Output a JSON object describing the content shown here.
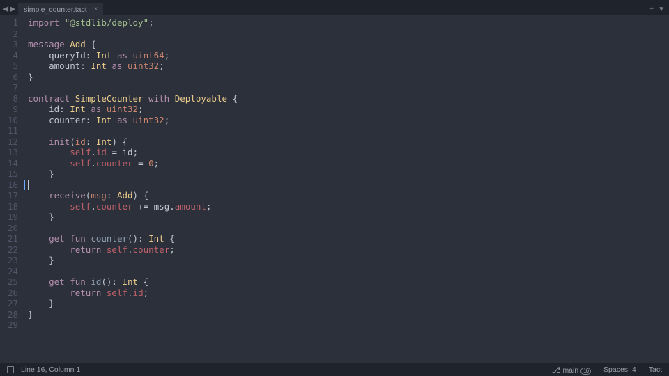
{
  "tab": {
    "filename": "simple_counter.tact",
    "nav_back": "◀",
    "nav_fwd": "▶",
    "close": "×",
    "plus": "+",
    "menu": "▼"
  },
  "cursor_line_index": 15,
  "code_lines": [
    [
      {
        "t": "import ",
        "c": "kw"
      },
      {
        "t": "\"@stdlib/deploy\"",
        "c": "str"
      },
      {
        "t": ";",
        "c": "pun"
      }
    ],
    [],
    [
      {
        "t": "message ",
        "c": "kw"
      },
      {
        "t": "Add ",
        "c": "ty2"
      },
      {
        "t": "{",
        "c": "pun"
      }
    ],
    [
      {
        "t": "    queryId",
        "c": "id"
      },
      {
        "t": ": ",
        "c": "pun"
      },
      {
        "t": "Int ",
        "c": "ty"
      },
      {
        "t": "as ",
        "c": "kw"
      },
      {
        "t": "uint64",
        "c": "as"
      },
      {
        "t": ";",
        "c": "pun"
      }
    ],
    [
      {
        "t": "    amount",
        "c": "id"
      },
      {
        "t": ": ",
        "c": "pun"
      },
      {
        "t": "Int ",
        "c": "ty"
      },
      {
        "t": "as ",
        "c": "kw"
      },
      {
        "t": "uint32",
        "c": "as"
      },
      {
        "t": ";",
        "c": "pun"
      }
    ],
    [
      {
        "t": "}",
        "c": "pun"
      }
    ],
    [],
    [
      {
        "t": "contract ",
        "c": "kw"
      },
      {
        "t": "SimpleCounter ",
        "c": "ty2"
      },
      {
        "t": "with ",
        "c": "kw"
      },
      {
        "t": "Deployable ",
        "c": "ty2"
      },
      {
        "t": "{",
        "c": "pun"
      }
    ],
    [
      {
        "t": "    id",
        "c": "id"
      },
      {
        "t": ": ",
        "c": "pun"
      },
      {
        "t": "Int ",
        "c": "ty"
      },
      {
        "t": "as ",
        "c": "kw"
      },
      {
        "t": "uint32",
        "c": "as"
      },
      {
        "t": ";",
        "c": "pun"
      }
    ],
    [
      {
        "t": "    counter",
        "c": "id"
      },
      {
        "t": ": ",
        "c": "pun"
      },
      {
        "t": "Int ",
        "c": "ty"
      },
      {
        "t": "as ",
        "c": "kw"
      },
      {
        "t": "uint32",
        "c": "as"
      },
      {
        "t": ";",
        "c": "pun"
      }
    ],
    [],
    [
      {
        "t": "    ",
        "c": "pun"
      },
      {
        "t": "init",
        "c": "kw2"
      },
      {
        "t": "(",
        "c": "pun"
      },
      {
        "t": "id",
        "c": "param"
      },
      {
        "t": ": ",
        "c": "pun"
      },
      {
        "t": "Int",
        "c": "ty"
      },
      {
        "t": ") {",
        "c": "pun"
      }
    ],
    [
      {
        "t": "        ",
        "c": "pun"
      },
      {
        "t": "self",
        "c": "self"
      },
      {
        "t": ".",
        "c": "pun"
      },
      {
        "t": "id",
        "c": "prop"
      },
      {
        "t": " = ",
        "c": "op"
      },
      {
        "t": "id",
        "c": "id"
      },
      {
        "t": ";",
        "c": "pun"
      }
    ],
    [
      {
        "t": "        ",
        "c": "pun"
      },
      {
        "t": "self",
        "c": "self"
      },
      {
        "t": ".",
        "c": "pun"
      },
      {
        "t": "counter",
        "c": "prop"
      },
      {
        "t": " = ",
        "c": "op"
      },
      {
        "t": "0",
        "c": "num"
      },
      {
        "t": ";",
        "c": "pun"
      }
    ],
    [
      {
        "t": "    }",
        "c": "pun"
      }
    ],
    [],
    [
      {
        "t": "    ",
        "c": "pun"
      },
      {
        "t": "receive",
        "c": "kw2"
      },
      {
        "t": "(",
        "c": "pun"
      },
      {
        "t": "msg",
        "c": "param"
      },
      {
        "t": ": ",
        "c": "pun"
      },
      {
        "t": "Add",
        "c": "ty2"
      },
      {
        "t": ") {",
        "c": "pun"
      }
    ],
    [
      {
        "t": "        ",
        "c": "pun"
      },
      {
        "t": "self",
        "c": "self"
      },
      {
        "t": ".",
        "c": "pun"
      },
      {
        "t": "counter",
        "c": "prop"
      },
      {
        "t": " += ",
        "c": "op"
      },
      {
        "t": "msg",
        "c": "id"
      },
      {
        "t": ".",
        "c": "pun"
      },
      {
        "t": "amount",
        "c": "prop"
      },
      {
        "t": ";",
        "c": "pun"
      }
    ],
    [
      {
        "t": "    }",
        "c": "pun"
      }
    ],
    [],
    [
      {
        "t": "    ",
        "c": "pun"
      },
      {
        "t": "get fun ",
        "c": "kw2"
      },
      {
        "t": "counter",
        "c": "fn"
      },
      {
        "t": "(): ",
        "c": "pun"
      },
      {
        "t": "Int ",
        "c": "ty"
      },
      {
        "t": "{",
        "c": "pun"
      }
    ],
    [
      {
        "t": "        ",
        "c": "pun"
      },
      {
        "t": "return ",
        "c": "kw"
      },
      {
        "t": "self",
        "c": "self"
      },
      {
        "t": ".",
        "c": "pun"
      },
      {
        "t": "counter",
        "c": "prop"
      },
      {
        "t": ";",
        "c": "pun"
      }
    ],
    [
      {
        "t": "    }",
        "c": "pun"
      }
    ],
    [],
    [
      {
        "t": "    ",
        "c": "pun"
      },
      {
        "t": "get fun ",
        "c": "kw2"
      },
      {
        "t": "id",
        "c": "fn"
      },
      {
        "t": "(): ",
        "c": "pun"
      },
      {
        "t": "Int ",
        "c": "ty"
      },
      {
        "t": "{",
        "c": "pun"
      }
    ],
    [
      {
        "t": "        ",
        "c": "pun"
      },
      {
        "t": "return ",
        "c": "kw"
      },
      {
        "t": "self",
        "c": "self"
      },
      {
        "t": ".",
        "c": "pun"
      },
      {
        "t": "id",
        "c": "prop"
      },
      {
        "t": ";",
        "c": "pun"
      }
    ],
    [
      {
        "t": "    }",
        "c": "pun"
      }
    ],
    [
      {
        "t": "}",
        "c": "pun"
      }
    ],
    []
  ],
  "status": {
    "position": "Line 16, Column 1",
    "branch_icon": "⎇",
    "branch": "main",
    "branch_changes": "16",
    "spaces": "Spaces: 4",
    "language": "Tact"
  }
}
